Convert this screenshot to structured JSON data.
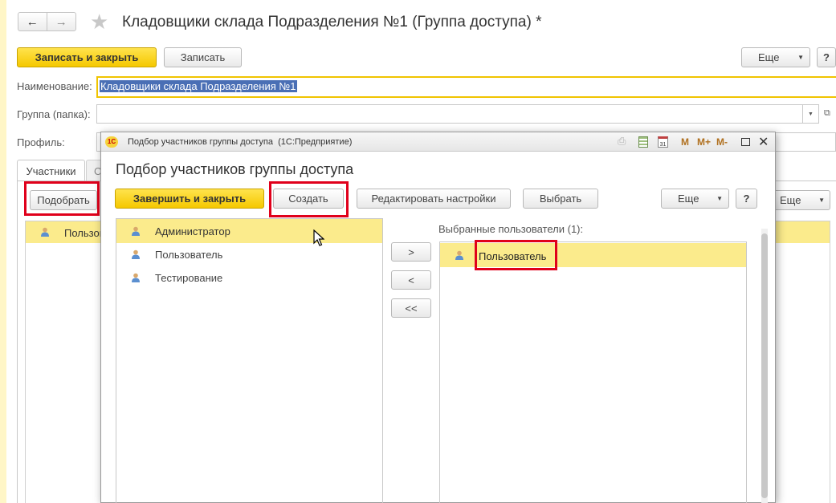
{
  "main": {
    "title": "Кладовщики склада Подразделения №1 (Группа доступа) *",
    "buttons": {
      "save_close": "Записать и закрыть",
      "save": "Записать",
      "more": "Еще",
      "help": "?"
    },
    "fields": {
      "name_label": "Наименование:",
      "name_value": "Кладовщики склада Подразделения №1",
      "group_label": "Группа (папка):",
      "profile_label": "Профиль:"
    },
    "tabs": {
      "participants": "Участники",
      "second_partial": "С"
    },
    "participants": {
      "pick_button": "Подобрать",
      "row_text": "Пользов",
      "more": "Еще"
    }
  },
  "dialog": {
    "window_title": "Подбор участников группы доступа  (1С:Предприятие)",
    "heading": "Подбор участников группы доступа",
    "toolbar_icons": {
      "m": "M",
      "m_plus": "M+",
      "m_minus": "M-"
    },
    "buttons": {
      "finish_close": "Завершить и закрыть",
      "create": "Создать",
      "edit_settings": "Редактировать настройки",
      "select": "Выбрать",
      "more": "Еще",
      "help": "?"
    },
    "users": [
      "Администратор",
      "Пользователь",
      "Тестирование"
    ],
    "transfer": {
      "add": ">",
      "remove": "<",
      "remove_all": "<<"
    },
    "selected_label": "Выбранные пользователи (1):",
    "selected": [
      "Пользователь"
    ]
  },
  "colors": {
    "accent_yellow": "#fbeb8c",
    "red_highlight": "#e0001b",
    "selection": "#4a6fb5"
  }
}
